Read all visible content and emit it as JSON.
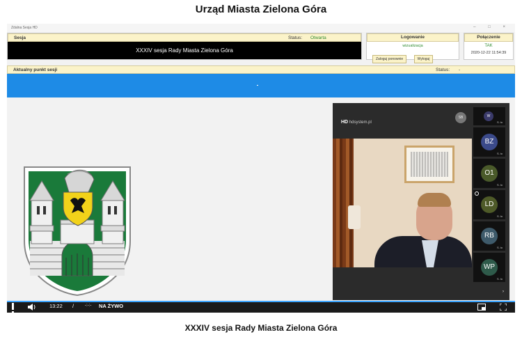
{
  "page_title": "Urząd Miasta Zielona Góra",
  "caption": "XXXIV sesja Rady Miasta Zielona Góra",
  "window": {
    "app_name": "Zdalna Sesja HD",
    "controls": [
      "–",
      "□",
      "×"
    ]
  },
  "sesja_panel": {
    "label": "Sesja",
    "status_label": "Status:",
    "status_value": "Otwarta",
    "session_name": "XXXIV sesja Rady Miasta Zielona Góra"
  },
  "logowanie_panel": {
    "label": "Logowanie",
    "mode": "wizualizacja",
    "login_remote_label": "Zaloguj ponownie",
    "logout_label": "Wyloguj"
  },
  "polaczenie_panel": {
    "label": "Połączenie",
    "connected": "TAK",
    "timestamp": "2020-12-22 11:54:39"
  },
  "punkt_panel": {
    "label": "Aktualny punkt sesji",
    "status_label": "Status:",
    "status_value": "-"
  },
  "video": {
    "provider": "hdsystem.pl",
    "speaker_badge": "SB",
    "participants": [
      {
        "initials": "W",
        "color": "#3a3a6a",
        "suffix": "S. ło"
      },
      {
        "initials": "BZ",
        "color": "#3b4a8a",
        "suffix": "S. ło"
      },
      {
        "initials": "O1",
        "color": "#4a5a2a",
        "suffix": "S. ło"
      },
      {
        "initials": "LD",
        "color": "#4e5a28",
        "suffix": "S. ło"
      },
      {
        "initials": "RB",
        "color": "#3e5a6a",
        "suffix": "S. ło"
      },
      {
        "initials": "WP",
        "color": "#2e5a4a",
        "suffix": "S. ło"
      }
    ],
    "more_label": "›"
  },
  "controls": {
    "time": "13:22",
    "separator": "/",
    "duration": "-:-:-",
    "live_label": "NA ŻYWO",
    "progress": 1.0
  }
}
